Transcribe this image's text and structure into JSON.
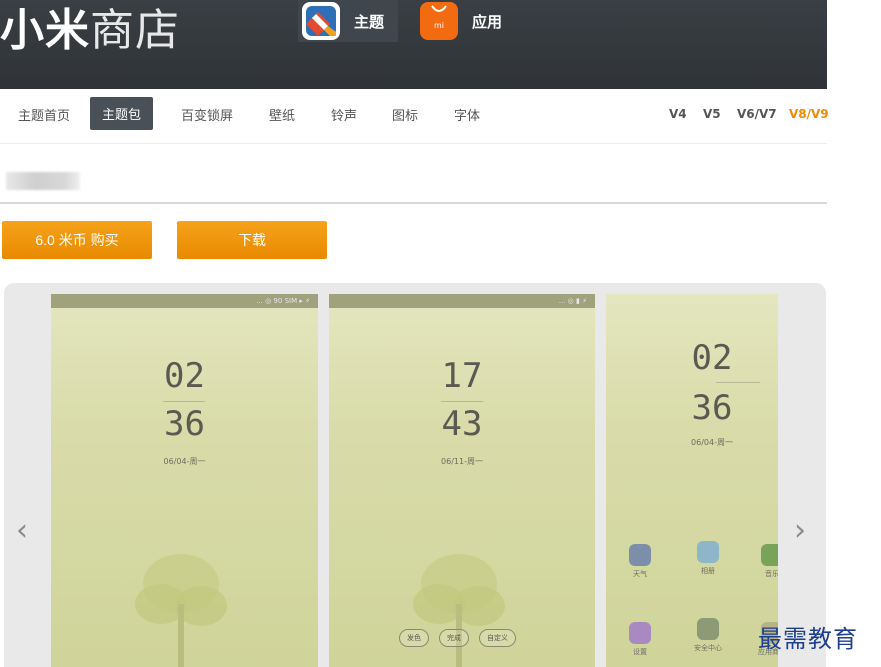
{
  "header": {
    "logo_bold": "小米",
    "logo_light": "商店",
    "tabs": [
      {
        "label": "主题",
        "icon": "theme-icon"
      },
      {
        "label": "应用",
        "icon": "mi-app-icon",
        "icon_text": "mi"
      }
    ]
  },
  "nav": {
    "items": [
      "主题首页",
      "主题包",
      "百变锁屏",
      "壁纸",
      "铃声",
      "图标",
      "字体"
    ],
    "active": "主题包",
    "versions": [
      "V4",
      "V5",
      "V6/V7",
      "V8/V9"
    ],
    "active_version": "V8/V9"
  },
  "actions": {
    "buy_label": "6.0 米币 购买",
    "download_label": "下载"
  },
  "gallery": {
    "prev_label": "‹",
    "next_label": "›",
    "screens": [
      {
        "hour": "02",
        "minute": "36",
        "date": "06/04-周一",
        "status": "... ◎ 90 SIM ▸ ⚡"
      },
      {
        "hour": "17",
        "minute": "43",
        "date": "06/11-周一",
        "status": "... ◎ ▮ ⚡",
        "buttons": [
          "发色",
          "完成",
          "自定义"
        ]
      },
      {
        "hour": "02",
        "minute": "36",
        "date": "06/04-周一",
        "apps": [
          "天气",
          "相册",
          "音乐",
          "设置",
          "安全中心",
          "应用商店"
        ]
      }
    ]
  },
  "watermark": "最需教育",
  "colors": {
    "accent": "#f08a00",
    "header_bg": "#34393d",
    "active_nav_bg": "#4a5057"
  }
}
